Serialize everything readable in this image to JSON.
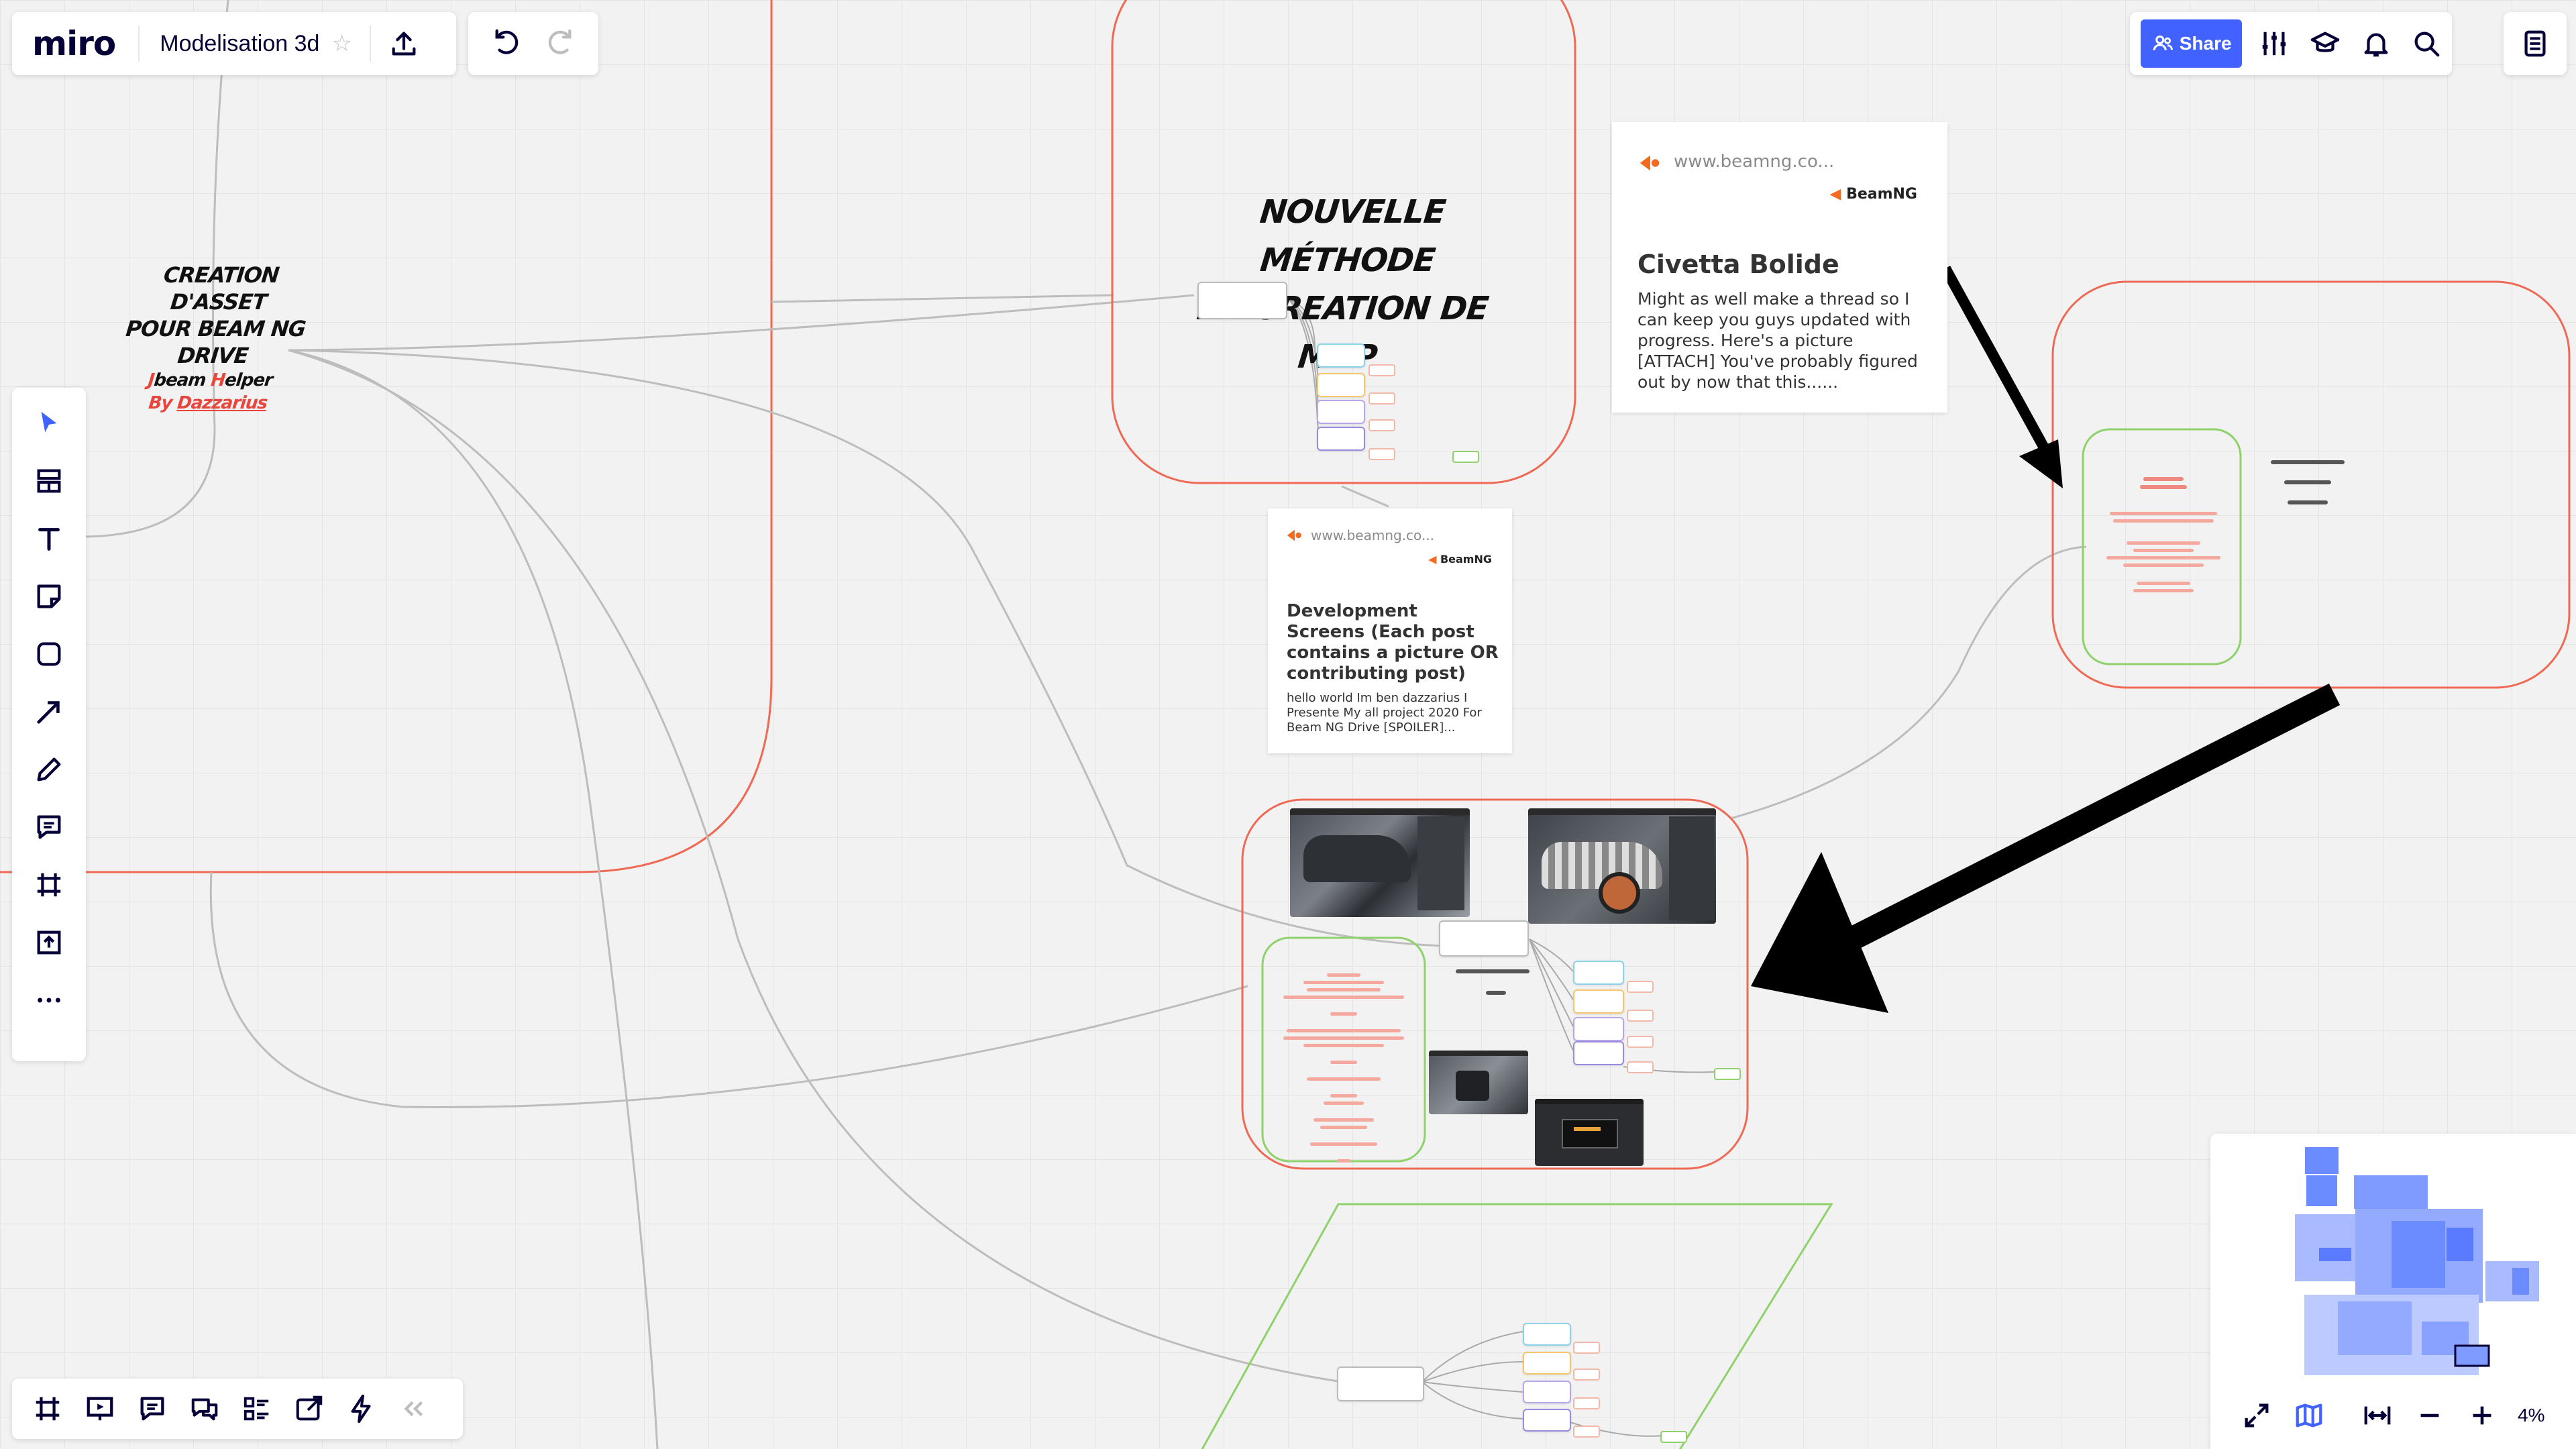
{
  "app": {
    "logo": "miro",
    "board_title": "Modelisation 3d"
  },
  "top_right": {
    "share_label": "Share"
  },
  "board": {
    "asset_title_line1": "CREATION D'ASSET",
    "asset_title_line2": "POUR BEAM NG DRIVE",
    "asset_subtitle_j": "J",
    "asset_subtitle_beam": "beam ",
    "asset_subtitle_h": "H",
    "asset_subtitle_helper": "elper",
    "asset_by": "By ",
    "asset_author": "Dazzarius",
    "map_title_line1": "NOUVELLE MÉTHODE",
    "map_title_line2": "DE CREATION DE MAP",
    "card1": {
      "url": "www.beamng.co...",
      "brand": "BeamNG",
      "title": "Civetta Bolide",
      "description": "Might as well make a thread so I can keep you guys updated with progress. Here's a picture  [ATTACH] You've probably figured out by now that this......"
    },
    "card2": {
      "url": "www.beamng.co...",
      "brand": "BeamNG",
      "title": "Development Screens (Each post contains a picture OR contributing post)",
      "description": "hello  world  Im ben dazzarius I Presente My all project 2020 For Beam NG Drive [SPOILER]..."
    }
  },
  "zoom": {
    "level": "4%"
  },
  "colors": {
    "accent": "#4262ff",
    "frame": "#ef6a55",
    "green_frame": "#8fd16a",
    "arrow": "#000000"
  }
}
